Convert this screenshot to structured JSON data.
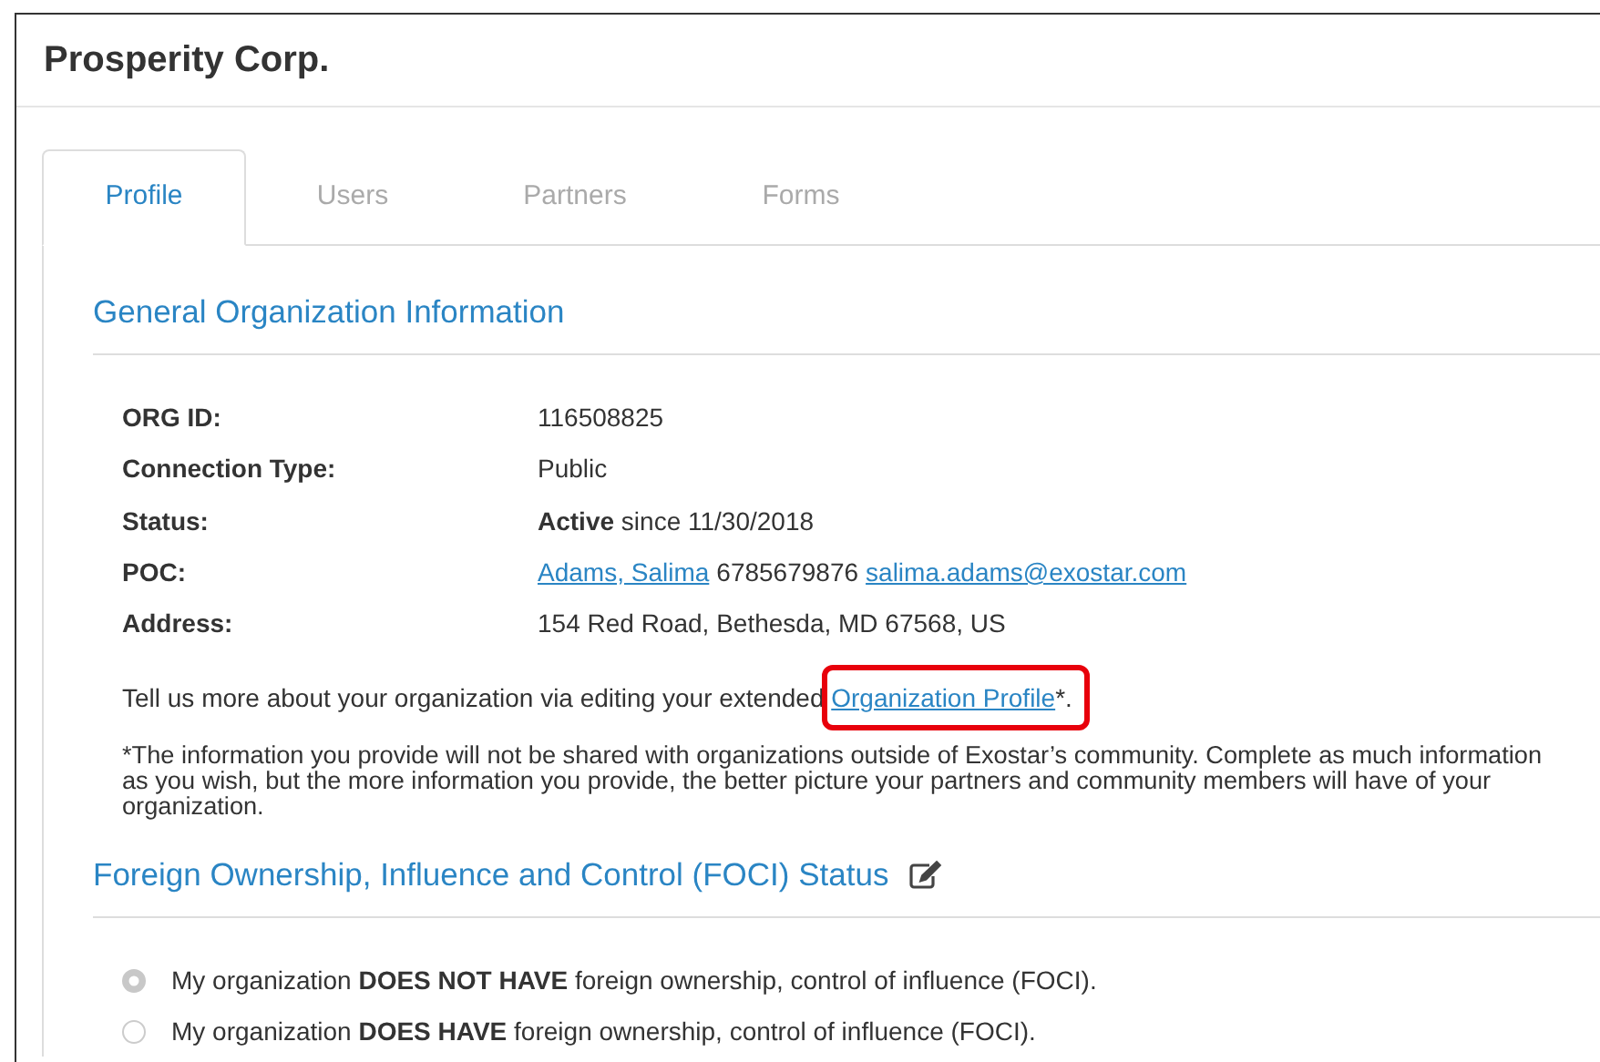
{
  "page_title": "Prosperity Corp.",
  "tabs": [
    {
      "label": "Profile",
      "selected": true
    },
    {
      "label": "Users",
      "selected": false
    },
    {
      "label": "Partners",
      "selected": false
    },
    {
      "label": "Forms",
      "selected": false
    }
  ],
  "general_section": {
    "heading": "General Organization Information",
    "fields": [
      {
        "label": "ORG ID:",
        "kind": "text",
        "value": "116508825"
      },
      {
        "label": "Connection Type:",
        "kind": "text",
        "value": "Public"
      },
      {
        "label": "Status:",
        "kind": "text",
        "value": "**Active** since 11/30/2018"
      },
      {
        "label": "POC:",
        "kind": "contact",
        "name": "Adams, Salima",
        "phone": "6785679876",
        "email": "salima.adams@exostar.com"
      },
      {
        "label": "Address:",
        "kind": "text",
        "value": "154 Red Road, Bethesda, MD 67568, US"
      }
    ],
    "extend_text": "Tell us more about your organization via editing your extended ",
    "profile_link": {
      "label": "Organization Profile",
      "suffix": "*.",
      "highlighted": true
    },
    "note_lines": [
      "*The information you provide will not be shared with organizations outside of Exostar’s community. Complete as much information",
      "as you wish, but the more information you provide, the better picture your partners and community members will have of your",
      "organization."
    ]
  },
  "foci_section": {
    "heading": "Foreign Ownership, Influence and Control (FOCI) Status",
    "options": [
      {
        "label": "My organization **DOES NOT HAVE** foreign ownership, control of influence (FOCI).",
        "selected": true,
        "disabled": true
      },
      {
        "label": "My organization **DOES HAVE** foreign ownership, control of influence (FOCI).",
        "selected": false,
        "disabled": true
      }
    ]
  }
}
